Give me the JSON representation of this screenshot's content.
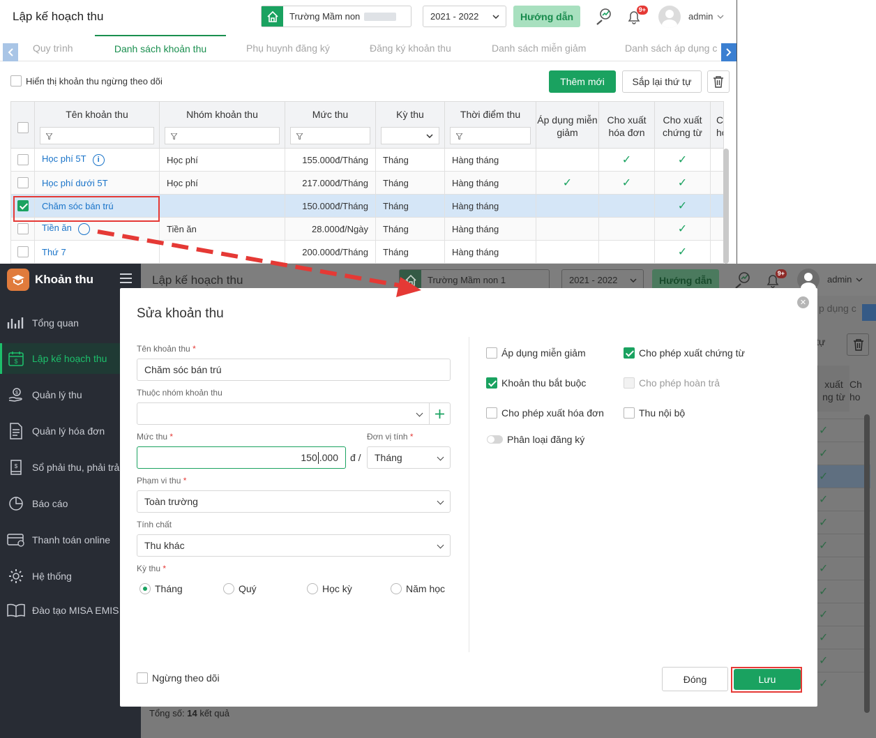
{
  "top": {
    "header": {
      "title": "Lập kế hoạch thu",
      "school": "Trường Mầm non",
      "year": "2021 - 2022",
      "guide": "Hướng dẫn",
      "badge": "9+",
      "user": "admin"
    },
    "tabs": [
      "Quy trình",
      "Danh sách khoản thu",
      "Phụ huynh đăng ký",
      "Đăng ký khoản thu",
      "Danh sách miễn giảm",
      "Danh sách áp dụng c"
    ],
    "toolbar": {
      "show_stopped": "Hiển thị khoản thu ngừng theo dõi",
      "add": "Thêm mới",
      "reorder": "Sắp lại thứ tự"
    },
    "table": {
      "columns": [
        "Tên khoản thu",
        "Nhóm khoản thu",
        "Mức thu",
        "Kỳ thu",
        "Thời điểm thu",
        "Áp dụng miễn giảm",
        "Cho xuất hóa đơn",
        "Cho xuất chứng từ",
        "Ch ho"
      ],
      "rows": [
        {
          "name": "Học phí 5T",
          "group": "Học phí",
          "amount": "155.000đ/Tháng",
          "period": "Tháng",
          "time": "Hàng tháng",
          "discount": false,
          "invoice": true,
          "voucher": true,
          "checked": false
        },
        {
          "name": "Học phí dưới 5T",
          "group": "Học phí",
          "amount": "217.000đ/Tháng",
          "period": "Tháng",
          "time": "Hàng tháng",
          "discount": true,
          "invoice": true,
          "voucher": true,
          "checked": false
        },
        {
          "name": "Chăm sóc bán trú",
          "group": "",
          "amount": "150.000đ/Tháng",
          "period": "Tháng",
          "time": "Hàng tháng",
          "discount": false,
          "invoice": false,
          "voucher": true,
          "checked": true
        },
        {
          "name": "Tiền ăn",
          "group": "Tiền ăn",
          "amount": "28.000đ/Ngày",
          "period": "Tháng",
          "time": "Hàng tháng",
          "discount": false,
          "invoice": false,
          "voucher": true,
          "checked": false
        },
        {
          "name": "Thứ 7",
          "group": "",
          "amount": "200.000đ/Tháng",
          "period": "Tháng",
          "time": "Hàng tháng",
          "discount": false,
          "invoice": false,
          "voucher": true,
          "checked": false
        }
      ]
    }
  },
  "bottom": {
    "app_name": "Khoản thu",
    "menu": [
      "Tổng quan",
      "Lập kế hoạch thu",
      "Quản lý thu",
      "Quản lý hóa đơn",
      "Sổ phải thu, phải trả",
      "Báo cáo",
      "Thanh toán online",
      "Hệ thống",
      "Đào tạo MISA EMIS"
    ],
    "header": {
      "title": "Lập kế hoạch thu",
      "school": "Trường Mầm non 1",
      "year": "2021 - 2022",
      "guide": "Hướng dẫn",
      "badge": "9+",
      "user": "admin"
    },
    "bg_fragments": {
      "tab": "p dụng c",
      "reorder": "tự",
      "col1": "xuất ng từ",
      "col2": "Ch ho"
    },
    "total": {
      "prefix": "Tổng số:",
      "count": "14",
      "suffix": "kết quả"
    },
    "modal": {
      "title": "Sửa khoản thu",
      "name_label": "Tên khoản thu",
      "name_value": "Chăm sóc bán trú",
      "group_label": "Thuộc nhóm khoản thu",
      "group_value": "",
      "amount_label": "Mức thu",
      "amount_before": "150",
      "amount_after": ".000",
      "currency": "đ /",
      "unit_label": "Đơn vị tính",
      "unit_value": "Tháng",
      "scope_label": "Phạm vi thu",
      "scope_value": "Toàn trường",
      "nature_label": "Tính chất",
      "nature_value": "Thu khác",
      "period_label": "Kỳ thu",
      "period_options": [
        "Tháng",
        "Quý",
        "Học kỳ",
        "Năm học"
      ],
      "period_selected": "Tháng",
      "options": {
        "discount": {
          "label": "Áp dụng miễn giảm",
          "checked": false
        },
        "voucher": {
          "label": "Cho phép xuất chứng từ",
          "checked": true
        },
        "mandatory": {
          "label": "Khoản thu bắt buộc",
          "checked": true
        },
        "refund": {
          "label": "Cho phép hoàn trả",
          "checked": false,
          "disabled": true
        },
        "invoice": {
          "label": "Cho phép xuất hóa đơn",
          "checked": false
        },
        "internal": {
          "label": "Thu nội bộ",
          "checked": false
        },
        "classify": {
          "label": "Phân loại đăng ký",
          "on": false
        }
      },
      "stop_tracking": "Ngừng theo dõi",
      "close": "Đóng",
      "save": "Lưu"
    }
  },
  "colors": {
    "primary_green": "#1aa260",
    "annotation_red": "#e53935",
    "link_blue": "#1a74c9",
    "sidebar_bg": "#282c34",
    "selected_row": "#d5e6f7"
  }
}
